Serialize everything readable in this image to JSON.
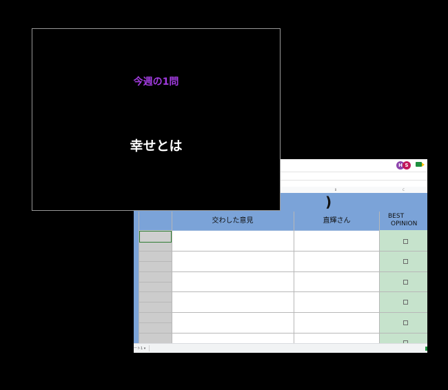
{
  "slide": {
    "subtitle": "今週の1問",
    "title": "幸せとは",
    "subtitle_color": "#a23ce0"
  },
  "sheet": {
    "avatars": [
      {
        "initial": "H",
        "color": "#8e44ad"
      },
      {
        "initial": "S",
        "color": "#c2185b"
      }
    ],
    "column_letters": [
      "B",
      "C"
    ],
    "banner_text": ")",
    "headers": {
      "opinion": "交わした意見",
      "direct": "直輝さん",
      "best_line1": "BEST",
      "best_line2": "OPINION"
    },
    "sheet_tab": "ート1 ▾",
    "colors": {
      "header_blue": "#7ba3d8",
      "best_green": "#c6e3cc",
      "row_gray": "#cccccc"
    }
  }
}
